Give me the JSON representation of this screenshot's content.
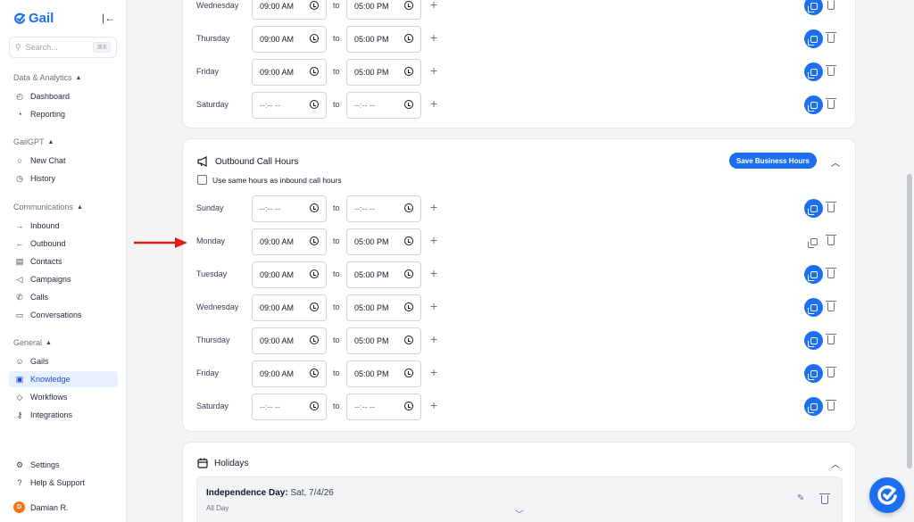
{
  "sidebar": {
    "brand": "Gail",
    "search_placeholder": "Search...",
    "search_shortcut": "⌘K",
    "sections": [
      {
        "title": "Data & Analytics",
        "items": [
          "Dashboard",
          "Reporting"
        ]
      },
      {
        "title": "GailGPT",
        "items": [
          "New Chat",
          "History"
        ]
      },
      {
        "title": "Communications",
        "items": [
          "Inbound",
          "Outbound",
          "Contacts",
          "Campaigns",
          "Calls",
          "Conversations"
        ]
      },
      {
        "title": "General",
        "items": [
          "Gails",
          "Knowledge",
          "Workflows",
          "Integrations"
        ]
      }
    ],
    "active_item": "Knowledge",
    "bottom": [
      "Settings",
      "Help & Support"
    ],
    "user": {
      "initial": "D",
      "name": "Damian R."
    }
  },
  "inbound_rows": [
    {
      "day": "Wednesday",
      "start": "09:00 AM",
      "end": "05:00 PM"
    },
    {
      "day": "Thursday",
      "start": "09:00 AM",
      "end": "05:00 PM"
    },
    {
      "day": "Friday",
      "start": "09:00 AM",
      "end": "05:00 PM"
    },
    {
      "day": "Saturday",
      "start": "--:-- --",
      "end": "--:-- --"
    }
  ],
  "outbound": {
    "title": "Outbound Call Hours",
    "save_label": "Save Business Hours",
    "same_hours_label": "Use same hours as inbound call hours",
    "to_label": "to",
    "rows": [
      {
        "day": "Sunday",
        "start": "--:-- --",
        "end": "--:-- --"
      },
      {
        "day": "Monday",
        "start": "09:00 AM",
        "end": "05:00 PM"
      },
      {
        "day": "Tuesday",
        "start": "09:00 AM",
        "end": "05:00 PM"
      },
      {
        "day": "Wednesday",
        "start": "09:00 AM",
        "end": "05:00 PM"
      },
      {
        "day": "Thursday",
        "start": "09:00 AM",
        "end": "05:00 PM"
      },
      {
        "day": "Friday",
        "start": "09:00 AM",
        "end": "05:00 PM"
      },
      {
        "day": "Saturday",
        "start": "--:-- --",
        "end": "--:-- --"
      }
    ]
  },
  "holidays": {
    "title": "Holidays",
    "items": [
      {
        "name": "Independence Day:",
        "date": "Sat, 7/4/26",
        "sub": "All Day"
      }
    ]
  },
  "colors": {
    "accent": "#1d6ff2",
    "arrow": "#e11d1d",
    "active_bg": "#e8f0fd"
  }
}
